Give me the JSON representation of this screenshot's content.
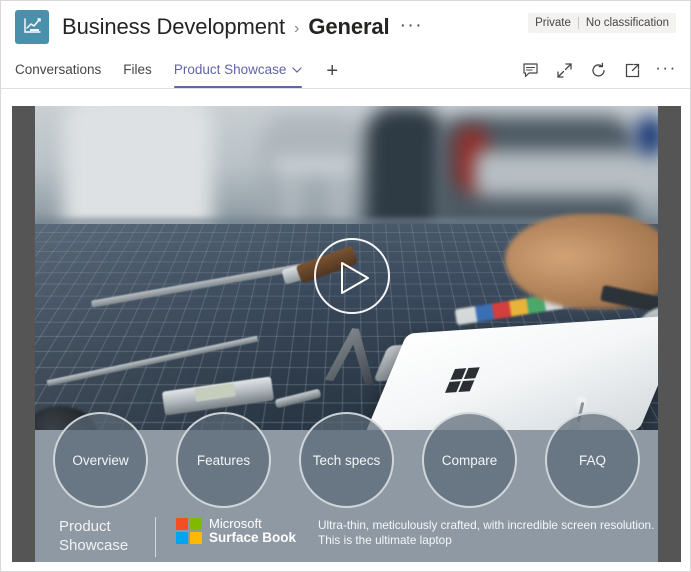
{
  "header": {
    "team_icon": "chart-icon",
    "team_name": "Business Development",
    "separator": "›",
    "channel_name": "General",
    "more_options": "···",
    "privacy_label": "Private",
    "classification_label": "No classification"
  },
  "tabs": {
    "items": [
      {
        "label": "Conversations",
        "active": false,
        "has_chevron": false
      },
      {
        "label": "Files",
        "active": false,
        "has_chevron": false
      },
      {
        "label": "Product Showcase",
        "active": true,
        "has_chevron": true
      }
    ],
    "add_label": "+",
    "tools": [
      {
        "name": "chat-icon",
        "label": "Show conversation"
      },
      {
        "name": "expand-icon",
        "label": "Expand"
      },
      {
        "name": "refresh-icon",
        "label": "Refresh"
      },
      {
        "name": "open-in-new-icon",
        "label": "Open in browser"
      },
      {
        "name": "more-options-icon",
        "label": "More options"
      }
    ],
    "more_dots": "···"
  },
  "showcase": {
    "play_button_label": "Play video",
    "nav_circles": [
      {
        "label": "Overview"
      },
      {
        "label": "Features"
      },
      {
        "label": "Tech specs"
      },
      {
        "label": "Compare"
      },
      {
        "label": "FAQ"
      }
    ],
    "brand_title_line1": "Product",
    "brand_title_line2": "Showcase",
    "microsoft_line1": "Microsoft",
    "microsoft_line2": "Surface Book",
    "description_line1": "Ultra-thin, meticulously crafted, with incredible screen resolution.",
    "description_line2": "This is the ultimate laptop"
  },
  "colors": {
    "accent": "#6264a7",
    "team_avatar": "#4a90ab",
    "panel": "#8e99a4",
    "letterbox": "#555555",
    "ms_red": "#f25022",
    "ms_green": "#7fba00",
    "ms_blue": "#00a4ef",
    "ms_yellow": "#ffb900"
  }
}
